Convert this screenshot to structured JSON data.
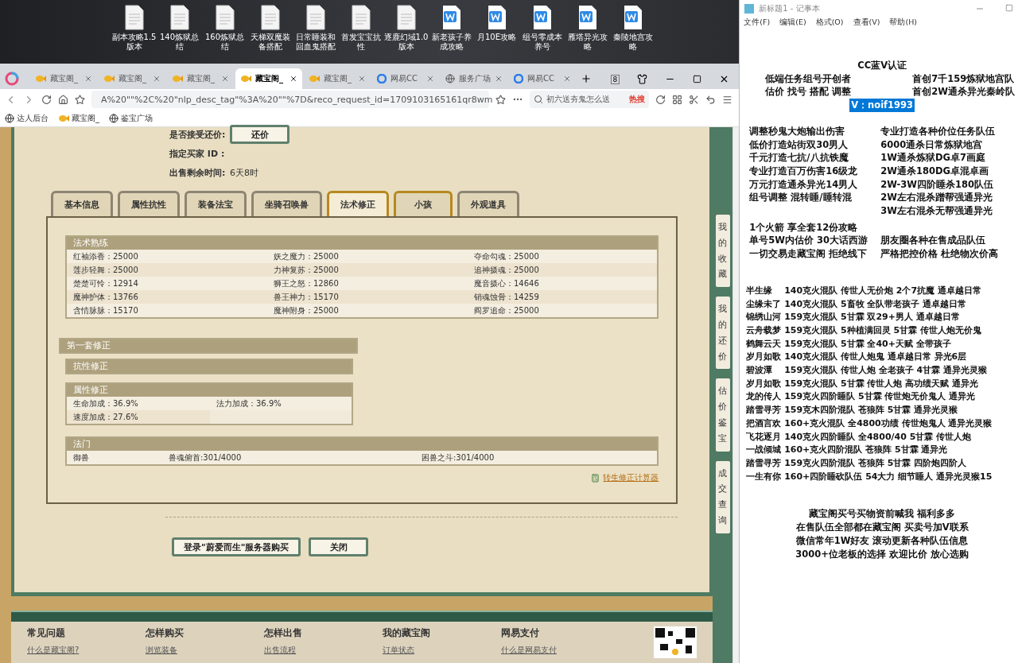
{
  "desktop": {
    "icons": [
      {
        "label": "副本攻略1.5版本",
        "kind": "doc"
      },
      {
        "label": "140炼狱总结",
        "kind": "doc"
      },
      {
        "label": "160炼狱总结",
        "kind": "doc"
      },
      {
        "label": "天梯双魔装备搭配",
        "kind": "doc"
      },
      {
        "label": "日常睡装和回血鬼搭配",
        "kind": "doc"
      },
      {
        "label": "首发宝宝抗性",
        "kind": "doc"
      },
      {
        "label": "逐鹿幻域1.0版本",
        "kind": "doc"
      },
      {
        "label": "新老孩子养成攻略",
        "kind": "word"
      },
      {
        "label": "月10E攻略",
        "kind": "word"
      },
      {
        "label": "组号零成本养号",
        "kind": "word"
      },
      {
        "label": "雁塔异光攻略",
        "kind": "word"
      },
      {
        "label": "秦陵地宫攻略",
        "kind": "word"
      }
    ]
  },
  "browser": {
    "tabs": [
      {
        "label": "藏宝阁_",
        "kind": "game",
        "selected": false
      },
      {
        "label": "藏宝阁_",
        "kind": "game",
        "selected": false
      },
      {
        "label": "藏宝阁_",
        "kind": "game",
        "selected": false
      },
      {
        "label": "藏宝阁_",
        "kind": "game",
        "selected": true
      },
      {
        "label": "藏宝阁_",
        "kind": "game",
        "selected": false
      },
      {
        "label": "网易CC",
        "kind": "cc",
        "selected": false
      },
      {
        "label": "服务广场",
        "kind": "globe",
        "selected": false
      },
      {
        "label": "网易CC",
        "kind": "cc",
        "selected": false
      }
    ],
    "tab_count": "8",
    "address": "A%20\"\"%2C%20\"nlp_desc_tag\"%3A%20\"\"%7D&reco_request_id=1709103165161qr8wm",
    "search": {
      "value": "初六送夯鬼怎么送",
      "hot": "热搜"
    },
    "bookmarks": [
      {
        "label": "达人后台",
        "kind": "globe"
      },
      {
        "label": "藏宝阁_",
        "kind": "game"
      },
      {
        "label": "鉴宝广场",
        "kind": "globe"
      }
    ]
  },
  "game": {
    "offer": [
      {
        "label": "是否接受还价:",
        "button": "还价"
      },
      {
        "label": "指定买家 ID :"
      },
      {
        "label": "出售剩余时间:",
        "value": "6天8时"
      }
    ],
    "tabs": [
      {
        "label": "基本信息",
        "selected": false,
        "hovered": false
      },
      {
        "label": "属性抗性",
        "selected": false,
        "hovered": false
      },
      {
        "label": "装备法宝",
        "selected": false,
        "hovered": false
      },
      {
        "label": "坐骑召唤兽",
        "selected": false,
        "hovered": false
      },
      {
        "label": "法术修正",
        "selected": true,
        "hovered": false
      },
      {
        "label": "小孩",
        "selected": false,
        "hovered": true
      },
      {
        "label": "外观道具",
        "selected": false,
        "hovered": false
      }
    ],
    "skills": {
      "title": "法术熟练",
      "items": [
        "红袖添香：25000",
        "妖之魔力：25000",
        "夺命勾魂：25000",
        "莲步轻舞：25000",
        "力神复苏：25000",
        "追神摄魂：25000",
        "楚楚可怜：12914",
        "狮王之怒：12860",
        "魔音摄心：14646",
        "魔神护体：13766",
        "兽王神力：15170",
        "销魂蚀骨：14259",
        "含情脉脉：15170",
        "魔神附身：25000",
        "阎罗追命：25000"
      ]
    },
    "correction": {
      "title": "第一套修正",
      "resist_title": "抗性修正",
      "attr_title": "属性修正",
      "attrs": [
        "生命加成：36.9%",
        "法力加成：36.9%",
        "速度加成：27.6%"
      ]
    },
    "method": {
      "title": "法门",
      "items": [
        "御兽",
        "兽魂俯首:301/4000",
        "困兽之斗:301/4000"
      ]
    },
    "calc_link": "转生修正计算器",
    "buttons": [
      "登录\"蔚爱而生\"服务器购买",
      "关闭"
    ],
    "side_nav": [
      "我的收藏",
      "我的还价",
      "估价鉴宝",
      "成交查询"
    ],
    "footer": [
      {
        "title": "常见问题",
        "link": "什么是藏宝阁?"
      },
      {
        "title": "怎样购买",
        "link": "浏览装备"
      },
      {
        "title": "怎样出售",
        "link": "出售流程"
      },
      {
        "title": "我的藏宝阁",
        "link": "订单状态"
      },
      {
        "title": "网易支付",
        "link": "什么是网易支付"
      }
    ]
  },
  "notepad": {
    "title": "新标题1 - 记事本",
    "menu": [
      "文件(F)",
      "编辑(E)",
      "格式(O)",
      "查看(V)",
      "帮助(H)"
    ],
    "header": "CC蓝V认证",
    "intro": [
      {
        "left": "低端任务组号开创者",
        "right": "首创7千159炼狱地宫队"
      },
      {
        "left": "估价 找号 搭配 调整",
        "right": "首创2W通杀异光秦岭队"
      }
    ],
    "contact": {
      "text": "V：noif1993",
      "selected": true
    },
    "services": [
      {
        "left": "调整秒鬼大炮输出伤害",
        "right": "专业打造各种价位任务队伍"
      },
      {
        "left": "低价打造站街双30男人",
        "right": "6000通杀日常炼狱地宫"
      },
      {
        "left": "千元打造七抗/八抗铁魔",
        "right": "1W通杀炼狱DG卓7画庭"
      },
      {
        "left": "专业打造百万伤害16级龙",
        "right": "2W通杀180DG卓混卓画"
      },
      {
        "left": "万元打造通杀异光14男人",
        "right": "2W-3W四阶睡杀180队伍"
      },
      {
        "left": "组号调整 混转睡/睡转混",
        "right": "2W左右混杀蹭帮强通异光"
      },
      {
        "right": "3W左右混杀无帮强通异光"
      }
    ],
    "offers": [
      {
        "left": "1个火箭 享全套12份攻略"
      },
      {
        "left": "单号5W内估价 30大话西游",
        "right": "朋友圈各种在售成品队伍"
      },
      {
        "left": "一切交易走藏宝阁 拒绝线下",
        "right": "严格把控价格 杜绝物次价高"
      }
    ],
    "teams": [
      "半生缘　 140克火混队 传世人无价炮 2个7抗魔 通卓越日常",
      "尘缘未了 140克火混队 5畜牧 全队带老孩子 通卓越日常",
      "锦绣山河 159克火混队 5甘霖 双29+男人 通卓越日常",
      "云舟载梦 159克火混队 5种植满回灵 5甘霖 传世人炮无价鬼",
      "鹤舞云天 159克火混队 5甘霖 全40+天赋 全带孩子",
      "岁月如歌 140克火混队 传世人炮鬼 通卓越日常 异光6层",
      "碧波潭　 159克火混队 传世人炮 全老孩子 4甘霖 通异光灵猴",
      "岁月如歌 159克火混队 5甘霖 传世人炮 高功绩天赋 通异光",
      "龙的传人 159克火四阶睡队 5甘霖 传世炮无价鬼人 通异光",
      "踏雪寻芳 159克木四阶混队 苍狼阵 5甘霖 通异光灵猴",
      "把酒言欢 160+克火混队 全4800功绩 传世炮鬼人 通异光灵猴",
      "飞花逐月 140克火四阶睡队 全4800/40 5甘霖 传世人炮",
      "一战倾城 160+克火四阶混队 苍狼阵 5甘霖 通异光",
      "踏雪寻芳 159克火四阶混队 苍狼阵 5甘霖 四阶炮四阶人",
      "一生有你 160+四阶睡砍队伍 54大力 细节睡人 通异光灵猴15"
    ],
    "closing": [
      "藏宝阁买号买物资前喊我 福利多多",
      "在售队伍全部都在藏宝阁 买卖号加V联系",
      "微信常年1W好友 滚动更新各种队伍信息",
      "3000+位老板的选择 欢迎比价 放心选购"
    ]
  }
}
